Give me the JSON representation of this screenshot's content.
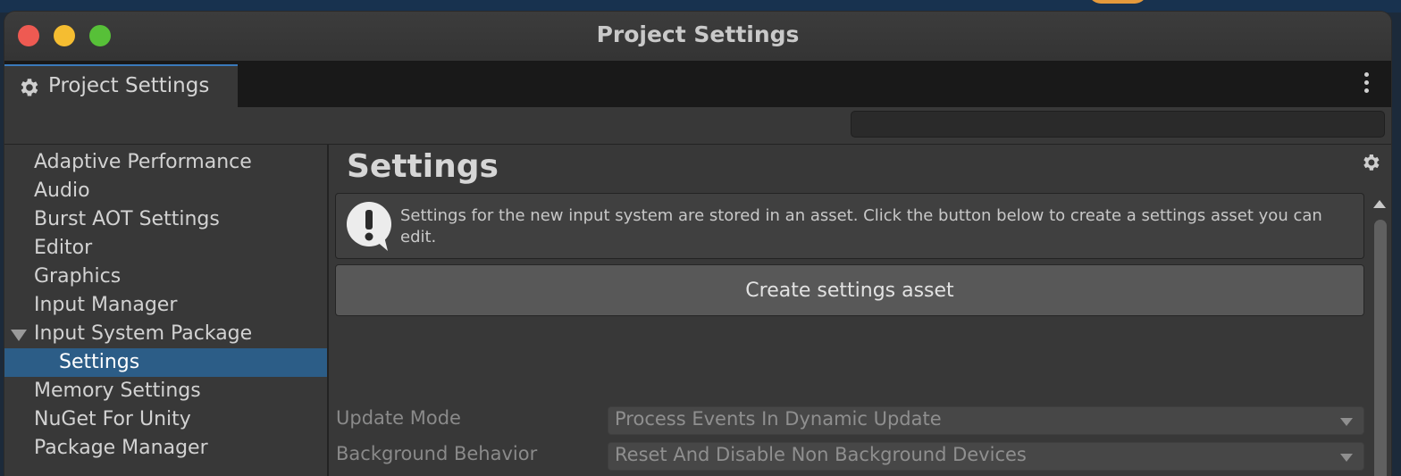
{
  "window": {
    "title": "Project Settings"
  },
  "tab": {
    "label": "Project Settings",
    "icon": "gear-icon"
  },
  "search": {
    "value": "",
    "placeholder": ""
  },
  "sidebar": {
    "items": [
      {
        "label": "Adaptive Performance"
      },
      {
        "label": "Audio"
      },
      {
        "label": "Burst AOT Settings"
      },
      {
        "label": "Editor"
      },
      {
        "label": "Graphics"
      },
      {
        "label": "Input Manager"
      },
      {
        "label": "Input System Package",
        "expanded": true
      },
      {
        "label": "Settings",
        "selected": true,
        "child": true
      },
      {
        "label": "Memory Settings"
      },
      {
        "label": "NuGet For Unity"
      },
      {
        "label": "Package Manager"
      }
    ]
  },
  "main": {
    "title": "Settings",
    "help_text": "Settings for the new input system are stored in an asset. Click the button below to create a settings asset you can edit.",
    "create_button": "Create settings asset",
    "fields": [
      {
        "label": "Update Mode",
        "value": "Process Events In Dynamic Update"
      },
      {
        "label": "Background Behavior",
        "value": "Reset And Disable Non Background Devices"
      }
    ]
  },
  "colors": {
    "selected_row": "#2c5d87",
    "tab_accent": "#3a79bb",
    "close": "#ee5a52",
    "minimize": "#f5bd31",
    "maximize": "#57c038"
  }
}
